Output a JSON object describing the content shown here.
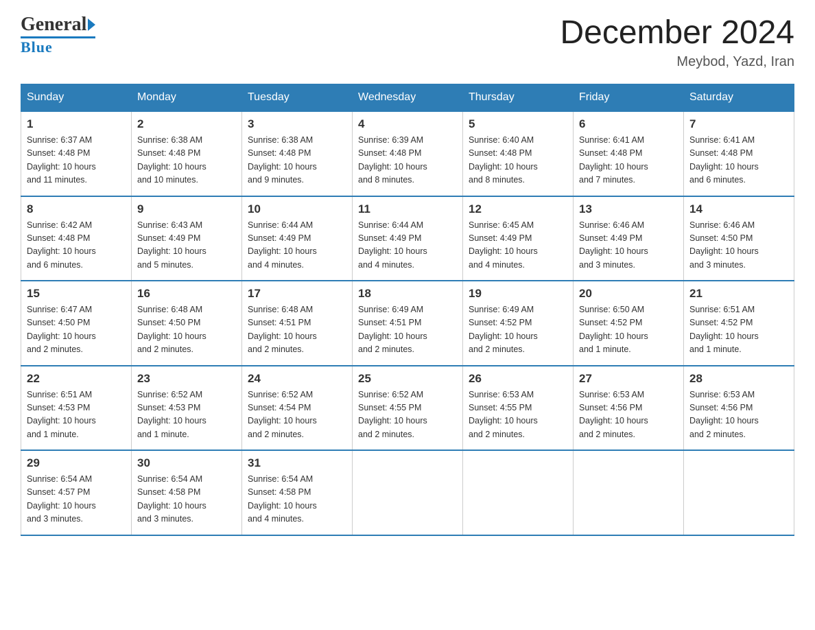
{
  "header": {
    "logo_text_general": "General",
    "logo_text_blue": "Blue",
    "month_title": "December 2024",
    "location": "Meybod, Yazd, Iran"
  },
  "weekdays": [
    "Sunday",
    "Monday",
    "Tuesday",
    "Wednesday",
    "Thursday",
    "Friday",
    "Saturday"
  ],
  "weeks": [
    [
      {
        "day": "1",
        "sunrise": "6:37 AM",
        "sunset": "4:48 PM",
        "daylight": "10 hours and 11 minutes."
      },
      {
        "day": "2",
        "sunrise": "6:38 AM",
        "sunset": "4:48 PM",
        "daylight": "10 hours and 10 minutes."
      },
      {
        "day": "3",
        "sunrise": "6:38 AM",
        "sunset": "4:48 PM",
        "daylight": "10 hours and 9 minutes."
      },
      {
        "day": "4",
        "sunrise": "6:39 AM",
        "sunset": "4:48 PM",
        "daylight": "10 hours and 8 minutes."
      },
      {
        "day": "5",
        "sunrise": "6:40 AM",
        "sunset": "4:48 PM",
        "daylight": "10 hours and 8 minutes."
      },
      {
        "day": "6",
        "sunrise": "6:41 AM",
        "sunset": "4:48 PM",
        "daylight": "10 hours and 7 minutes."
      },
      {
        "day": "7",
        "sunrise": "6:41 AM",
        "sunset": "4:48 PM",
        "daylight": "10 hours and 6 minutes."
      }
    ],
    [
      {
        "day": "8",
        "sunrise": "6:42 AM",
        "sunset": "4:48 PM",
        "daylight": "10 hours and 6 minutes."
      },
      {
        "day": "9",
        "sunrise": "6:43 AM",
        "sunset": "4:49 PM",
        "daylight": "10 hours and 5 minutes."
      },
      {
        "day": "10",
        "sunrise": "6:44 AM",
        "sunset": "4:49 PM",
        "daylight": "10 hours and 4 minutes."
      },
      {
        "day": "11",
        "sunrise": "6:44 AM",
        "sunset": "4:49 PM",
        "daylight": "10 hours and 4 minutes."
      },
      {
        "day": "12",
        "sunrise": "6:45 AM",
        "sunset": "4:49 PM",
        "daylight": "10 hours and 4 minutes."
      },
      {
        "day": "13",
        "sunrise": "6:46 AM",
        "sunset": "4:49 PM",
        "daylight": "10 hours and 3 minutes."
      },
      {
        "day": "14",
        "sunrise": "6:46 AM",
        "sunset": "4:50 PM",
        "daylight": "10 hours and 3 minutes."
      }
    ],
    [
      {
        "day": "15",
        "sunrise": "6:47 AM",
        "sunset": "4:50 PM",
        "daylight": "10 hours and 2 minutes."
      },
      {
        "day": "16",
        "sunrise": "6:48 AM",
        "sunset": "4:50 PM",
        "daylight": "10 hours and 2 minutes."
      },
      {
        "day": "17",
        "sunrise": "6:48 AM",
        "sunset": "4:51 PM",
        "daylight": "10 hours and 2 minutes."
      },
      {
        "day": "18",
        "sunrise": "6:49 AM",
        "sunset": "4:51 PM",
        "daylight": "10 hours and 2 minutes."
      },
      {
        "day": "19",
        "sunrise": "6:49 AM",
        "sunset": "4:52 PM",
        "daylight": "10 hours and 2 minutes."
      },
      {
        "day": "20",
        "sunrise": "6:50 AM",
        "sunset": "4:52 PM",
        "daylight": "10 hours and 1 minute."
      },
      {
        "day": "21",
        "sunrise": "6:51 AM",
        "sunset": "4:52 PM",
        "daylight": "10 hours and 1 minute."
      }
    ],
    [
      {
        "day": "22",
        "sunrise": "6:51 AM",
        "sunset": "4:53 PM",
        "daylight": "10 hours and 1 minute."
      },
      {
        "day": "23",
        "sunrise": "6:52 AM",
        "sunset": "4:53 PM",
        "daylight": "10 hours and 1 minute."
      },
      {
        "day": "24",
        "sunrise": "6:52 AM",
        "sunset": "4:54 PM",
        "daylight": "10 hours and 2 minutes."
      },
      {
        "day": "25",
        "sunrise": "6:52 AM",
        "sunset": "4:55 PM",
        "daylight": "10 hours and 2 minutes."
      },
      {
        "day": "26",
        "sunrise": "6:53 AM",
        "sunset": "4:55 PM",
        "daylight": "10 hours and 2 minutes."
      },
      {
        "day": "27",
        "sunrise": "6:53 AM",
        "sunset": "4:56 PM",
        "daylight": "10 hours and 2 minutes."
      },
      {
        "day": "28",
        "sunrise": "6:53 AM",
        "sunset": "4:56 PM",
        "daylight": "10 hours and 2 minutes."
      }
    ],
    [
      {
        "day": "29",
        "sunrise": "6:54 AM",
        "sunset": "4:57 PM",
        "daylight": "10 hours and 3 minutes."
      },
      {
        "day": "30",
        "sunrise": "6:54 AM",
        "sunset": "4:58 PM",
        "daylight": "10 hours and 3 minutes."
      },
      {
        "day": "31",
        "sunrise": "6:54 AM",
        "sunset": "4:58 PM",
        "daylight": "10 hours and 4 minutes."
      },
      null,
      null,
      null,
      null
    ]
  ],
  "labels": {
    "sunrise": "Sunrise:",
    "sunset": "Sunset:",
    "daylight": "Daylight:"
  }
}
